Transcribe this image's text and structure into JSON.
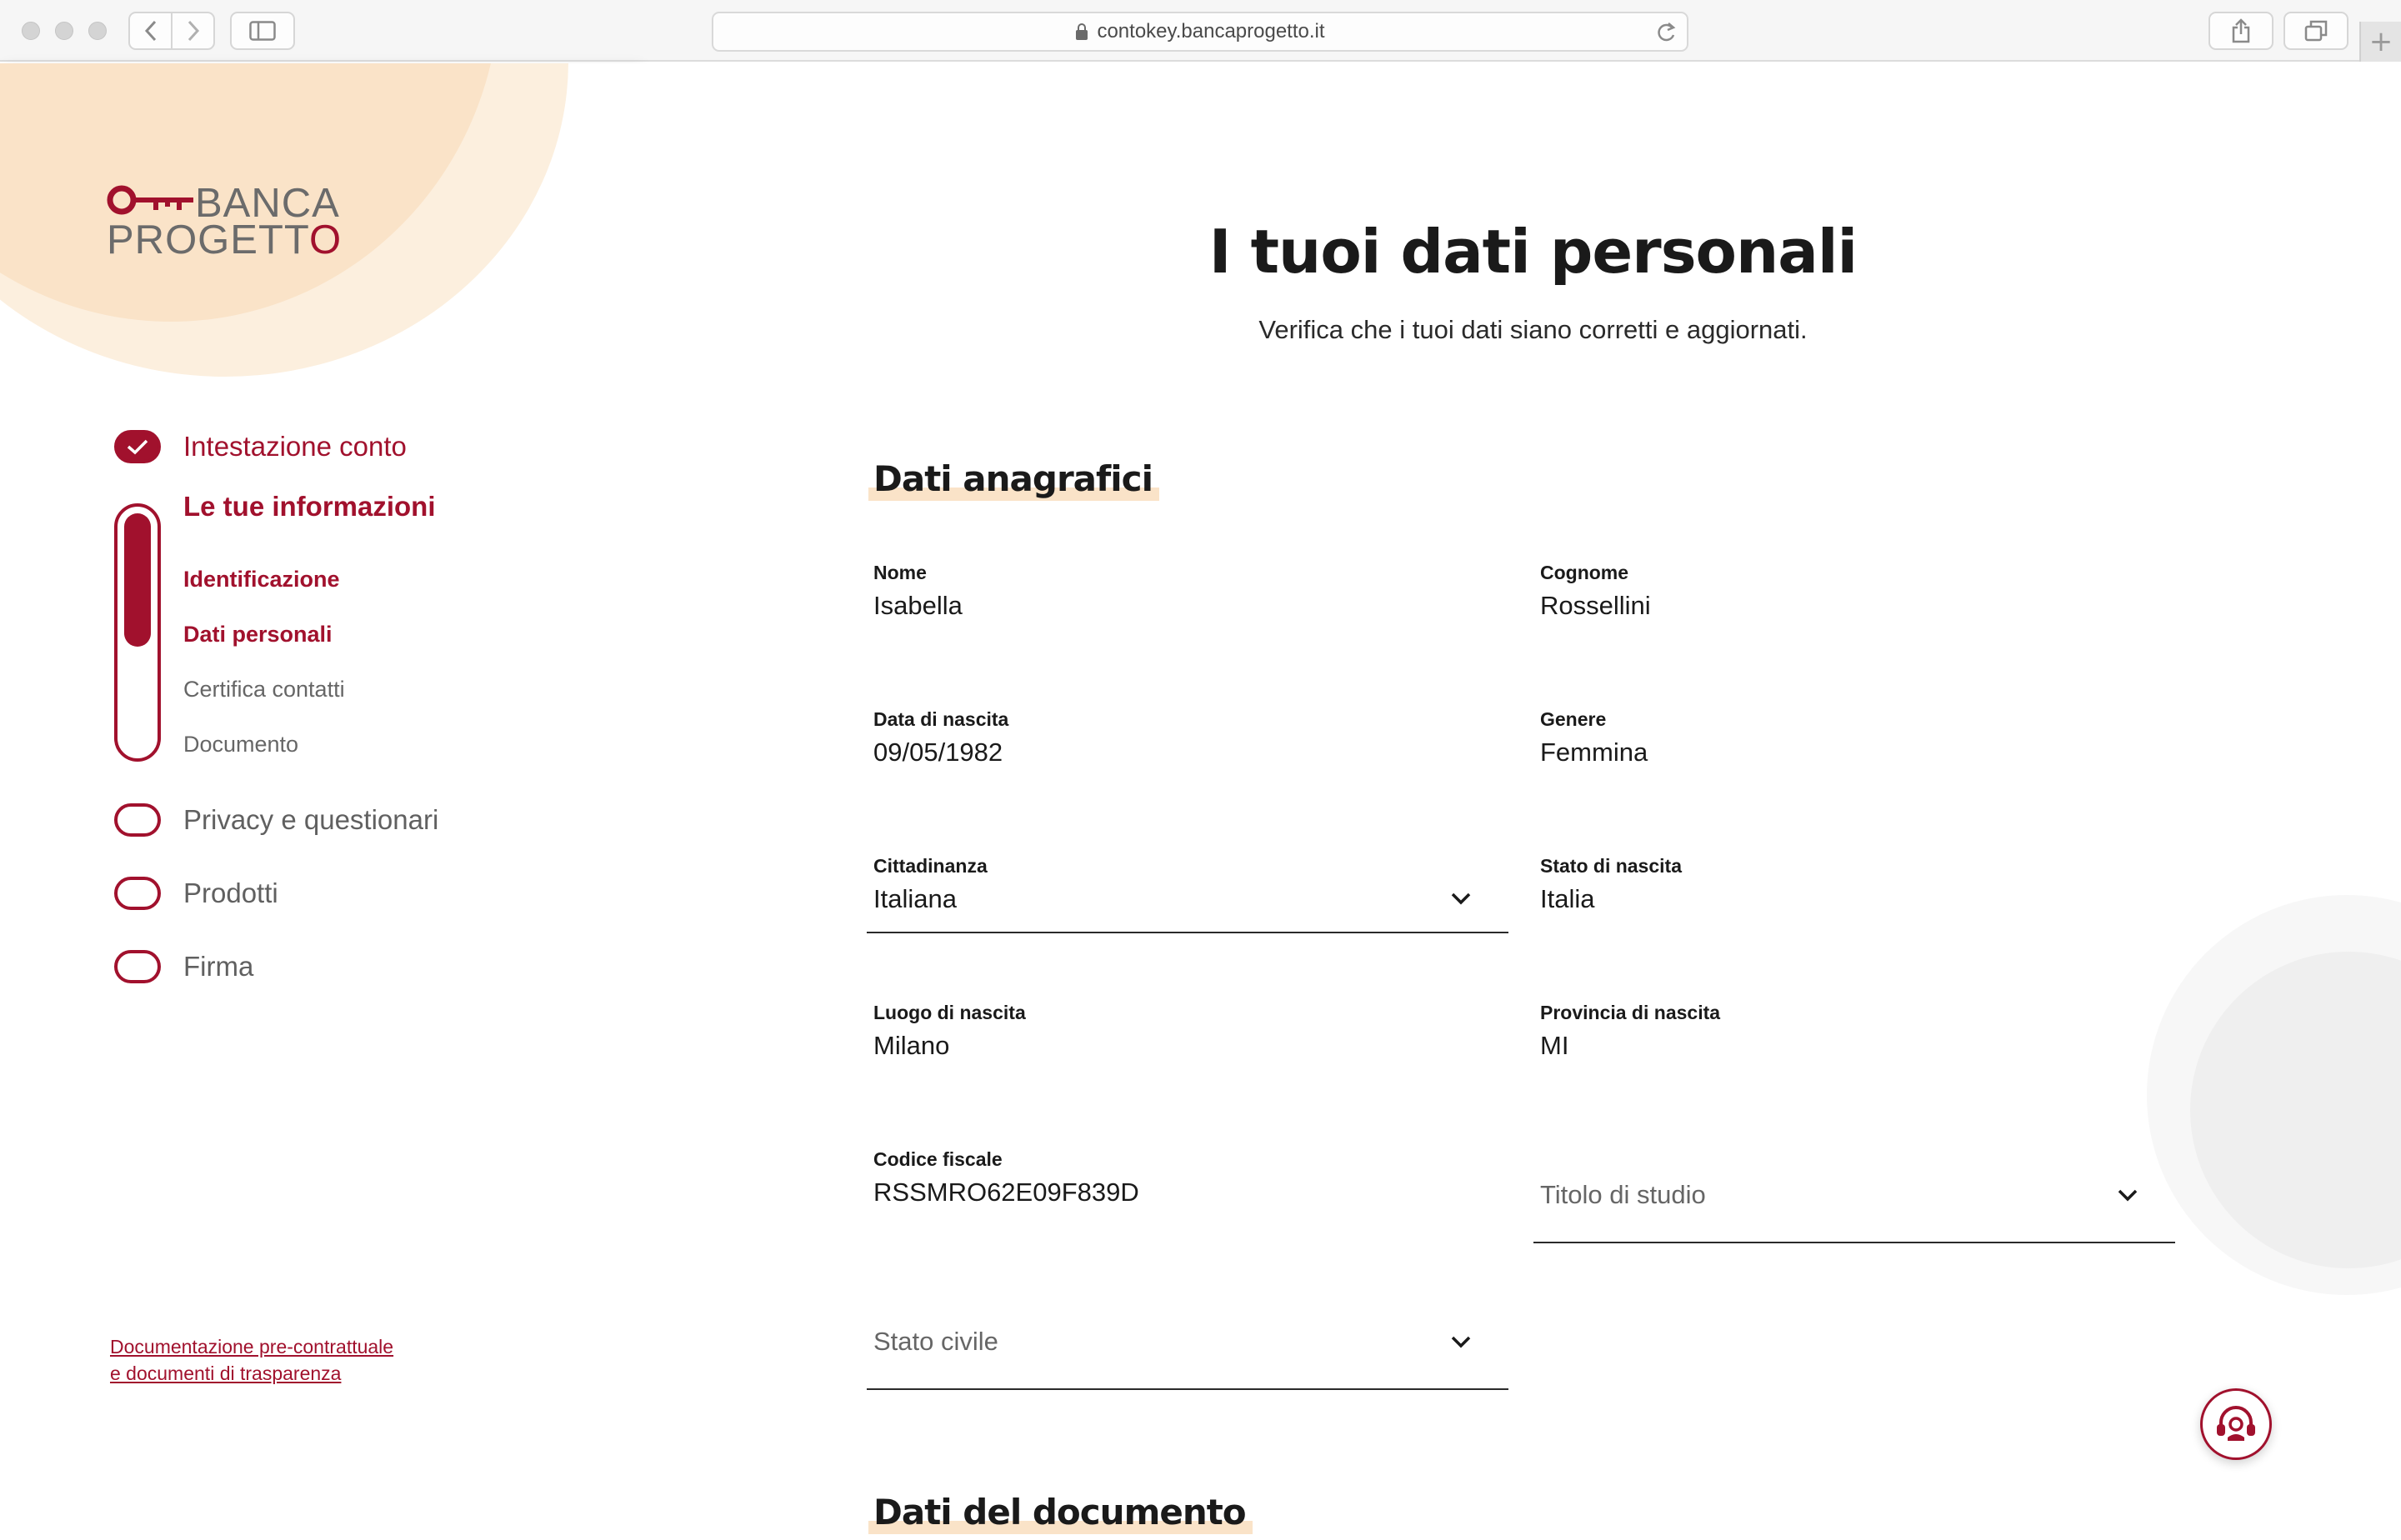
{
  "browser": {
    "url": "contokey.bancaprogetto.it"
  },
  "brand": {
    "line1": "BANCA",
    "line2": "PROGETTO",
    "accent_color": "#a1112d",
    "highlight_color": "#fae3c8"
  },
  "sidebar": {
    "steps": [
      {
        "label": "Intestazione conto",
        "state": "done"
      },
      {
        "label": "Le tue informazioni",
        "state": "active"
      },
      {
        "label": "Privacy e questionari",
        "state": "todo"
      },
      {
        "label": "Prodotti",
        "state": "todo"
      },
      {
        "label": "Firma",
        "state": "todo"
      }
    ],
    "substeps": [
      {
        "label": "Identificazione",
        "state": "done"
      },
      {
        "label": "Dati personali",
        "state": "active"
      },
      {
        "label": "Certifica contatti",
        "state": "todo"
      },
      {
        "label": "Documento",
        "state": "todo"
      }
    ],
    "doc_link_line1": "Documentazione pre-contrattuale",
    "doc_link_line2": "e documenti di trasparenza"
  },
  "main": {
    "title": "I tuoi dati personali",
    "subtitle": "Verifica che i tuoi dati siano corretti e aggiornati.",
    "section1_title": "Dati anagrafici",
    "section2_title": "Dati del documento",
    "fields": {
      "nome": {
        "label": "Nome",
        "value": "Isabella"
      },
      "cognome": {
        "label": "Cognome",
        "value": "Rossellini"
      },
      "data_nascita": {
        "label": "Data di nascita",
        "value": "09/05/1982"
      },
      "genere": {
        "label": "Genere",
        "value": "Femmina"
      },
      "cittadinanza": {
        "label": "Cittadinanza",
        "value": "Italiana"
      },
      "stato_nascita": {
        "label": "Stato di nascita",
        "value": "Italia"
      },
      "luogo_nascita": {
        "label": "Luogo di nascita",
        "value": "Milano"
      },
      "provincia_nascita": {
        "label": "Provincia di nascita",
        "value": "MI"
      },
      "codice_fiscale": {
        "label": "Codice fiscale",
        "value": "RSSMRO62E09F839D"
      },
      "titolo_studio": {
        "placeholder": "Titolo di studio"
      },
      "stato_civile": {
        "placeholder": "Stato civile"
      }
    }
  }
}
